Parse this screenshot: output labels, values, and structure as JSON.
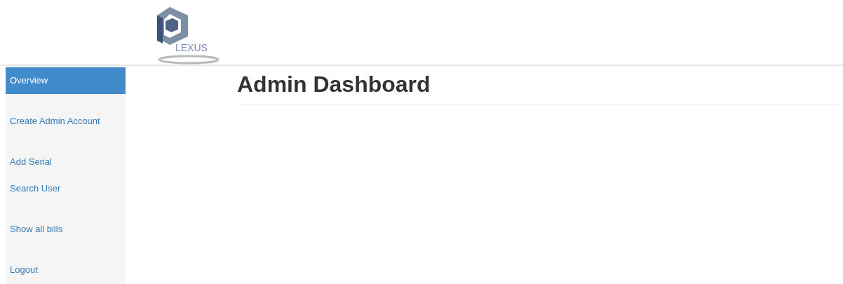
{
  "header": {
    "logo_text": "LEXUS"
  },
  "sidebar": {
    "groups": [
      [
        {
          "label": "Overview",
          "selected": true
        }
      ],
      [
        {
          "label": "Create Admin Account",
          "selected": false
        }
      ],
      [
        {
          "label": "Add Serial",
          "selected": false
        },
        {
          "label": "Search User",
          "selected": false
        }
      ],
      [
        {
          "label": "Show all bills",
          "selected": false
        }
      ],
      [
        {
          "label": "Logout",
          "selected": false
        }
      ]
    ]
  },
  "main": {
    "title": "Admin Dashboard"
  }
}
